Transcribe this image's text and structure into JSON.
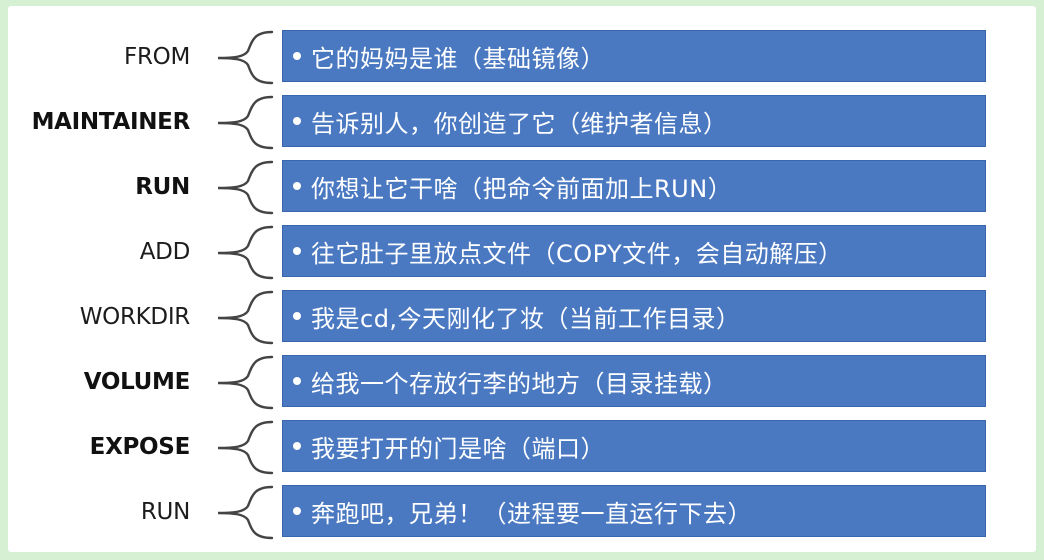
{
  "rows": [
    {
      "keyword": "FROM",
      "description": "它的妈妈是谁（基础镜像）",
      "bold": false
    },
    {
      "keyword": "MAINTAINER",
      "description": "告诉别人，你创造了它（维护者信息）",
      "bold": true
    },
    {
      "keyword": "RUN",
      "description": "你想让它干啥（把命令前面加上RUN）",
      "bold": true
    },
    {
      "keyword": "ADD",
      "description": "往它肚子里放点文件（COPY文件，会自动解压）",
      "bold": false
    },
    {
      "keyword": "WORKDIR",
      "description": "我是cd,今天刚化了妆（当前工作目录）",
      "bold": false
    },
    {
      "keyword": "VOLUME",
      "description": "给我一个存放行李的地方（目录挂载）",
      "bold": true
    },
    {
      "keyword": "EXPOSE",
      "description": "我要打开的门是啥（端口）",
      "bold": true
    },
    {
      "keyword": "RUN",
      "description": "奔跑吧，兄弟！（进程要一直运行下去）",
      "bold": false
    }
  ],
  "colors": {
    "box_fill": "#4a79c2",
    "box_text": "#ffffff",
    "keyword_text": "#1c1c1c",
    "page_border": "#d6f0d3"
  }
}
